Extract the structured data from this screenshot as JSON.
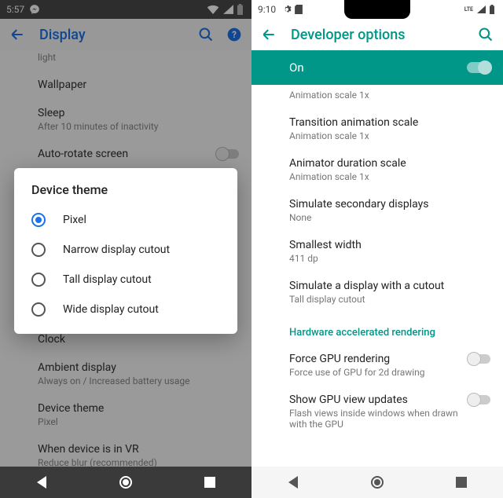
{
  "left": {
    "status": {
      "time": "5:57"
    },
    "header": {
      "title": "Display"
    },
    "items_top": [
      {
        "title": "",
        "sub": "light"
      },
      {
        "title": "Wallpaper",
        "sub": ""
      },
      {
        "title": "Sleep",
        "sub": "After 10 minutes of inactivity"
      },
      {
        "title": "Auto-rotate screen",
        "sub": "",
        "toggle": true
      }
    ],
    "dialog": {
      "title": "Device theme",
      "options": [
        {
          "label": "Pixel",
          "selected": true
        },
        {
          "label": "Narrow display cutout",
          "selected": false
        },
        {
          "label": "Tall display cutout",
          "selected": false
        },
        {
          "label": "Wide display cutout",
          "selected": false
        }
      ]
    },
    "items_bottom": [
      {
        "title": "Clock",
        "sub": ""
      },
      {
        "title": "Ambient display",
        "sub": "Always on / Increased battery usage"
      },
      {
        "title": "Device theme",
        "sub": "Pixel"
      },
      {
        "title": "When device is in VR",
        "sub": "Reduce blur (recommended)"
      }
    ]
  },
  "right": {
    "status": {
      "time": "9:10",
      "net": "LTE"
    },
    "header": {
      "title": "Developer options"
    },
    "on_label": "On",
    "items": [
      {
        "title": "",
        "sub": "Animation scale 1x"
      },
      {
        "title": "Transition animation scale",
        "sub": "Animation scale 1x"
      },
      {
        "title": "Animator duration scale",
        "sub": "Animation scale 1x"
      },
      {
        "title": "Simulate secondary displays",
        "sub": "None"
      },
      {
        "title": "Smallest width",
        "sub": "411 dp"
      },
      {
        "title": "Simulate a display with a cutout",
        "sub": "Tall display cutout"
      }
    ],
    "section": "Hardware accelerated rendering",
    "items2": [
      {
        "title": "Force GPU rendering",
        "sub": "Force use of GPU for 2d drawing",
        "toggle": true
      },
      {
        "title": "Show GPU view updates",
        "sub": "Flash views inside windows when drawn with the GPU",
        "toggle": true
      }
    ]
  }
}
